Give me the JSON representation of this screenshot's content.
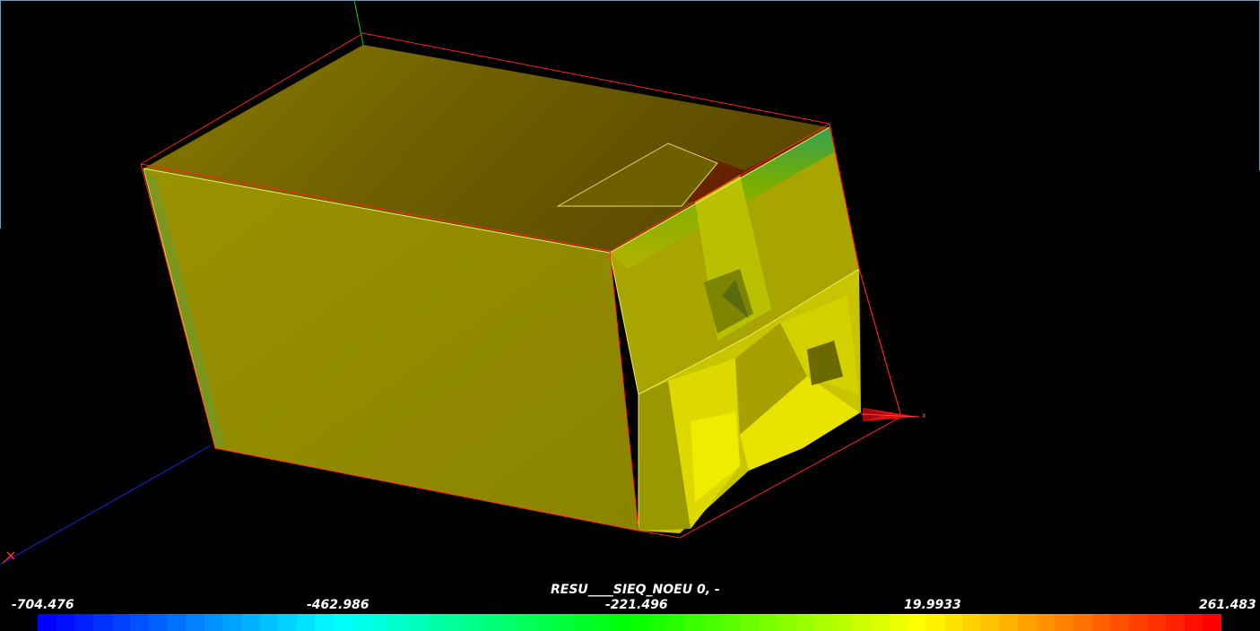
{
  "scalar_bar": {
    "title": "RESU____SIEQ_NOEU 0, -",
    "labels": [
      "-704.476",
      "-462.986",
      "-221.496",
      "19.9933",
      "261.483"
    ],
    "min": -704.476,
    "max": 261.483,
    "colormap": "blue-cyan-green-yellow-red"
  },
  "axes": {
    "x_label": "x"
  },
  "colors": {
    "background": "#000000",
    "bounding_box": "#ff2020",
    "mesh_edges": "#ffff66",
    "surface_main": "#8c8c00"
  }
}
